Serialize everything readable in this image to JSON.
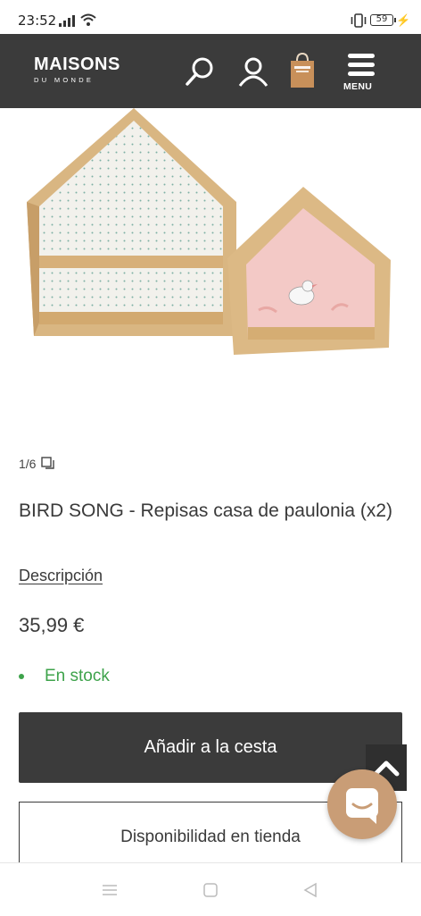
{
  "status": {
    "time": "23:52",
    "battery": "59",
    "icons": [
      "signal-icon",
      "wifi-icon",
      "vibrate-icon",
      "battery-icon",
      "charging-icon"
    ]
  },
  "header": {
    "brand_main": "MAISONS",
    "brand_sub": "DU MONDE",
    "menu_label": "MENU",
    "background": "#3b3b3b",
    "icons": [
      "search-icon",
      "user-icon",
      "shopping-bag-icon",
      "menu-icon"
    ]
  },
  "product": {
    "image_counter": "1/6",
    "title": "BIRD SONG - Repisas casa de paulonia (x2)",
    "description_link": "Descripción",
    "price": "35,99 €",
    "stock_status": "En stock",
    "stock_color": "#3ea34b"
  },
  "actions": {
    "add_to_cart": "Añadir a la cesta",
    "store_availability": "Disponibilidad en tienda",
    "chat_color": "#c99d76"
  },
  "nav": {
    "icons": [
      "recent-apps-icon",
      "home-icon",
      "back-icon"
    ]
  }
}
